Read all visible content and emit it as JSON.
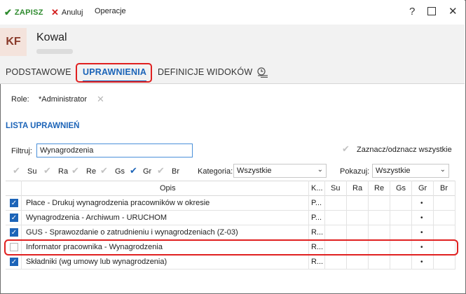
{
  "toolbar": {
    "save_label": "ZAPISZ",
    "cancel_label": "Anuluj",
    "operations_label": "Operacje",
    "help_label": "?"
  },
  "header": {
    "initials": "KF",
    "name": "Kowal"
  },
  "tabs": [
    {
      "label": "PODSTAWOWE"
    },
    {
      "label": "UPRAWNIENIA"
    },
    {
      "label": "DEFINICJE WIDOKÓW"
    }
  ],
  "roles": {
    "label": "Role:",
    "value": "*Administrator"
  },
  "section_title": "LISTA UPRAWNIEŃ",
  "filter": {
    "label": "Filtruj:",
    "value": "Wynagrodzenia"
  },
  "select_all_label": "Zaznacz/odznacz wszystkie",
  "flags": [
    {
      "label": "Su",
      "checked": false
    },
    {
      "label": "Ra",
      "checked": false
    },
    {
      "label": "Re",
      "checked": false
    },
    {
      "label": "Gs",
      "checked": false
    },
    {
      "label": "Gr",
      "checked": true
    },
    {
      "label": "Br",
      "checked": false
    }
  ],
  "category": {
    "label": "Kategoria:",
    "value": "Wszystkie"
  },
  "show": {
    "label": "Pokazuj:",
    "value": "Wszystkie"
  },
  "table": {
    "columns": [
      "Opis",
      "K...",
      "Su",
      "Ra",
      "Re",
      "Gs",
      "Gr",
      "Br"
    ],
    "rows": [
      {
        "checked": true,
        "opis": "Płace - Drukuj wynagrodzenia pracowników w okresie",
        "k": "P...",
        "gr": "•"
      },
      {
        "checked": true,
        "opis": "Wynagrodzenia - Archiwum - URUCHOM",
        "k": "P...",
        "gr": "•"
      },
      {
        "checked": true,
        "opis": "GUS - Sprawozdanie o zatrudnieniu i wynagrodzeniach (Z-03)",
        "k": "R...",
        "gr": "•"
      },
      {
        "checked": false,
        "opis": "Informator pracownika - Wynagrodzenia",
        "k": "R...",
        "gr": "•"
      },
      {
        "checked": true,
        "opis": "Składniki (wg umowy lub wynagrodzenia)",
        "k": "R...",
        "gr": "•"
      }
    ]
  },
  "colors": {
    "accent": "#1c64b8",
    "save_green": "#2e8b2e",
    "cancel_red": "#d32020",
    "highlight_red": "#e02020"
  }
}
